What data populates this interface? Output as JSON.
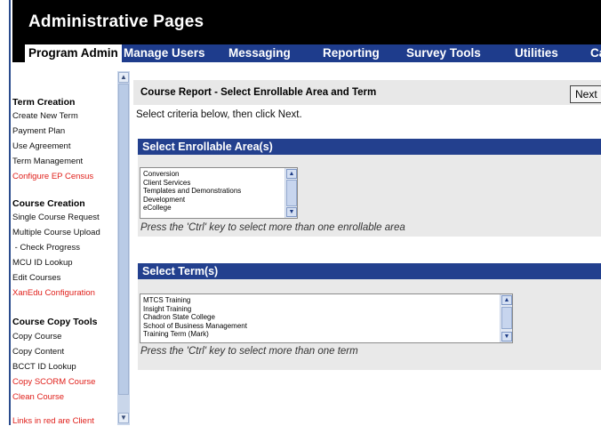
{
  "header": {
    "title": "Administrative Pages"
  },
  "nav": {
    "items": [
      {
        "label": "Program Admin"
      },
      {
        "label": "Manage Users"
      },
      {
        "label": "Messaging"
      },
      {
        "label": "Reporting"
      },
      {
        "label": "Survey Tools"
      },
      {
        "label": "Utilities"
      },
      {
        "label": "Ca"
      }
    ]
  },
  "sidebar": {
    "sections": [
      {
        "title": "Term Creation",
        "links": [
          {
            "label": "Create New Term",
            "red": false
          },
          {
            "label": "Payment Plan",
            "red": false
          },
          {
            "label": "Use Agreement",
            "red": false
          },
          {
            "label": "Term Management",
            "red": false
          },
          {
            "label": "Configure EP Census",
            "red": true
          }
        ]
      },
      {
        "title": "Course Creation",
        "links": [
          {
            "label": "Single Course Request",
            "red": false
          },
          {
            "label": "Multiple Course Upload",
            "red": false
          },
          {
            "label": " - Check Progress",
            "red": false
          },
          {
            "label": "MCU ID Lookup",
            "red": false
          },
          {
            "label": "Edit Courses",
            "red": false
          },
          {
            "label": "XanEdu Configuration",
            "red": true
          }
        ]
      },
      {
        "title": "Course Copy Tools",
        "links": [
          {
            "label": "Copy Course",
            "red": false
          },
          {
            "label": "Copy Content",
            "red": false
          },
          {
            "label": "BCCT ID Lookup",
            "red": false
          },
          {
            "label": "Copy SCORM Course",
            "red": true
          },
          {
            "label": "Clean Course",
            "red": true
          }
        ]
      }
    ],
    "footer_note": "Links in red are Client"
  },
  "main": {
    "title": "Course Report - Select Enrollable Area and Term",
    "next_label": "Next",
    "instructions": "Select criteria below, then click Next.",
    "enrollable": {
      "heading": "Select Enrollable Area(s)",
      "options": [
        "Conversion",
        "Client Services",
        "Templates and Demonstrations",
        "Development",
        "eCollege"
      ],
      "hint": "Press the 'Ctrl' key to select more than one enrollable area"
    },
    "terms": {
      "heading": "Select Term(s)",
      "options": [
        "MTCS Training",
        "Insight Training",
        "Chadron State College",
        "School of Business Management",
        "Training Term (Mark)"
      ],
      "hint": "Press the 'Ctrl' key to select more than one term"
    }
  },
  "colors": {
    "header_bg": "#000000",
    "nav_bg": "#1e3c8c",
    "panel_head_bg": "#23408e",
    "red_link": "#e0201b"
  },
  "icons": {
    "scroll_up": "up-arrow-icon",
    "scroll_down": "down-arrow-icon"
  }
}
